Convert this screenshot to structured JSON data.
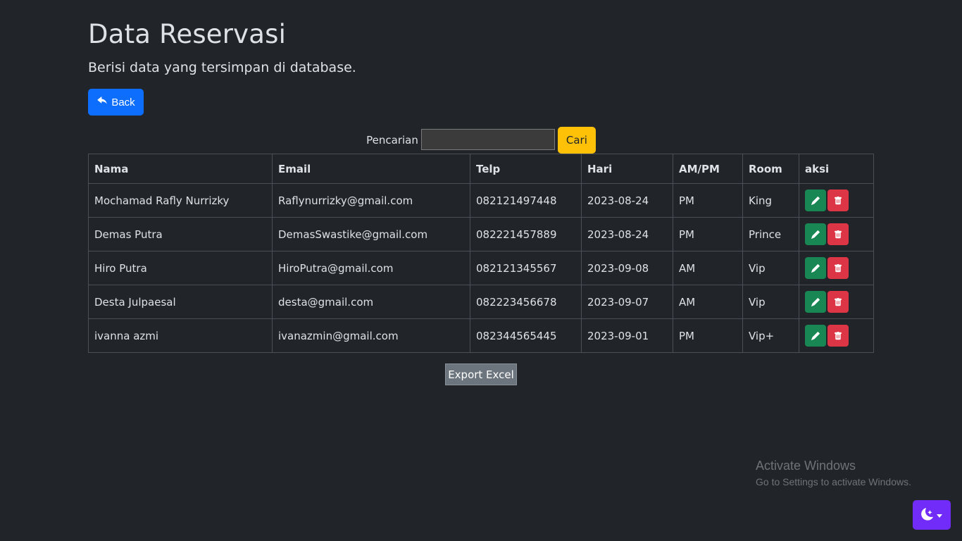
{
  "header": {
    "title": "Data Reservasi",
    "subtitle": "Berisi data yang tersimpan di database."
  },
  "back_button": {
    "label": "Back",
    "icon": "reply-arrow-icon"
  },
  "search": {
    "label": "Pencarian",
    "value": "",
    "button_label": "Cari"
  },
  "table": {
    "columns": [
      "Nama",
      "Email",
      "Telp",
      "Hari",
      "AM/PM",
      "Room",
      "aksi"
    ],
    "rows": [
      {
        "nama": "Mochamad Rafly Nurrizky",
        "email": "Raflynurrizky@gmail.com",
        "telp": "082121497448",
        "hari": "2023-08-24",
        "ampm": "PM",
        "room": "King"
      },
      {
        "nama": "Demas Putra",
        "email": "DemasSwastike@gmail.com",
        "telp": "082221457889",
        "hari": "2023-08-24",
        "ampm": "PM",
        "room": "Prince"
      },
      {
        "nama": "Hiro Putra",
        "email": "HiroPutra@gmail.com",
        "telp": "082121345567",
        "hari": "2023-09-08",
        "ampm": "AM",
        "room": "Vip"
      },
      {
        "nama": "Desta Julpaesal",
        "email": "desta@gmail.com",
        "telp": "082223456678",
        "hari": "2023-09-07",
        "ampm": "AM",
        "room": "Vip"
      },
      {
        "nama": "ivanna azmi",
        "email": "ivanazmin@gmail.com",
        "telp": "082344565445",
        "hari": "2023-09-01",
        "ampm": "PM",
        "room": "Vip+"
      }
    ],
    "action_icons": {
      "edit": "pencil-icon",
      "delete": "trash-icon"
    }
  },
  "export_button": {
    "label": "Export Excel"
  },
  "watermark": {
    "title": "Activate Windows",
    "subtitle": "Go to Settings to activate Windows."
  },
  "theme_toggle": {
    "icon": "moon-stars-icon",
    "caret": "caret-down-icon"
  },
  "colors": {
    "background": "#212529",
    "primary": "#0d6efd",
    "warning": "#ffc107",
    "success": "#198754",
    "danger": "#dc3545",
    "secondary": "#6c757d",
    "theme_toggle": "#712cf9"
  }
}
